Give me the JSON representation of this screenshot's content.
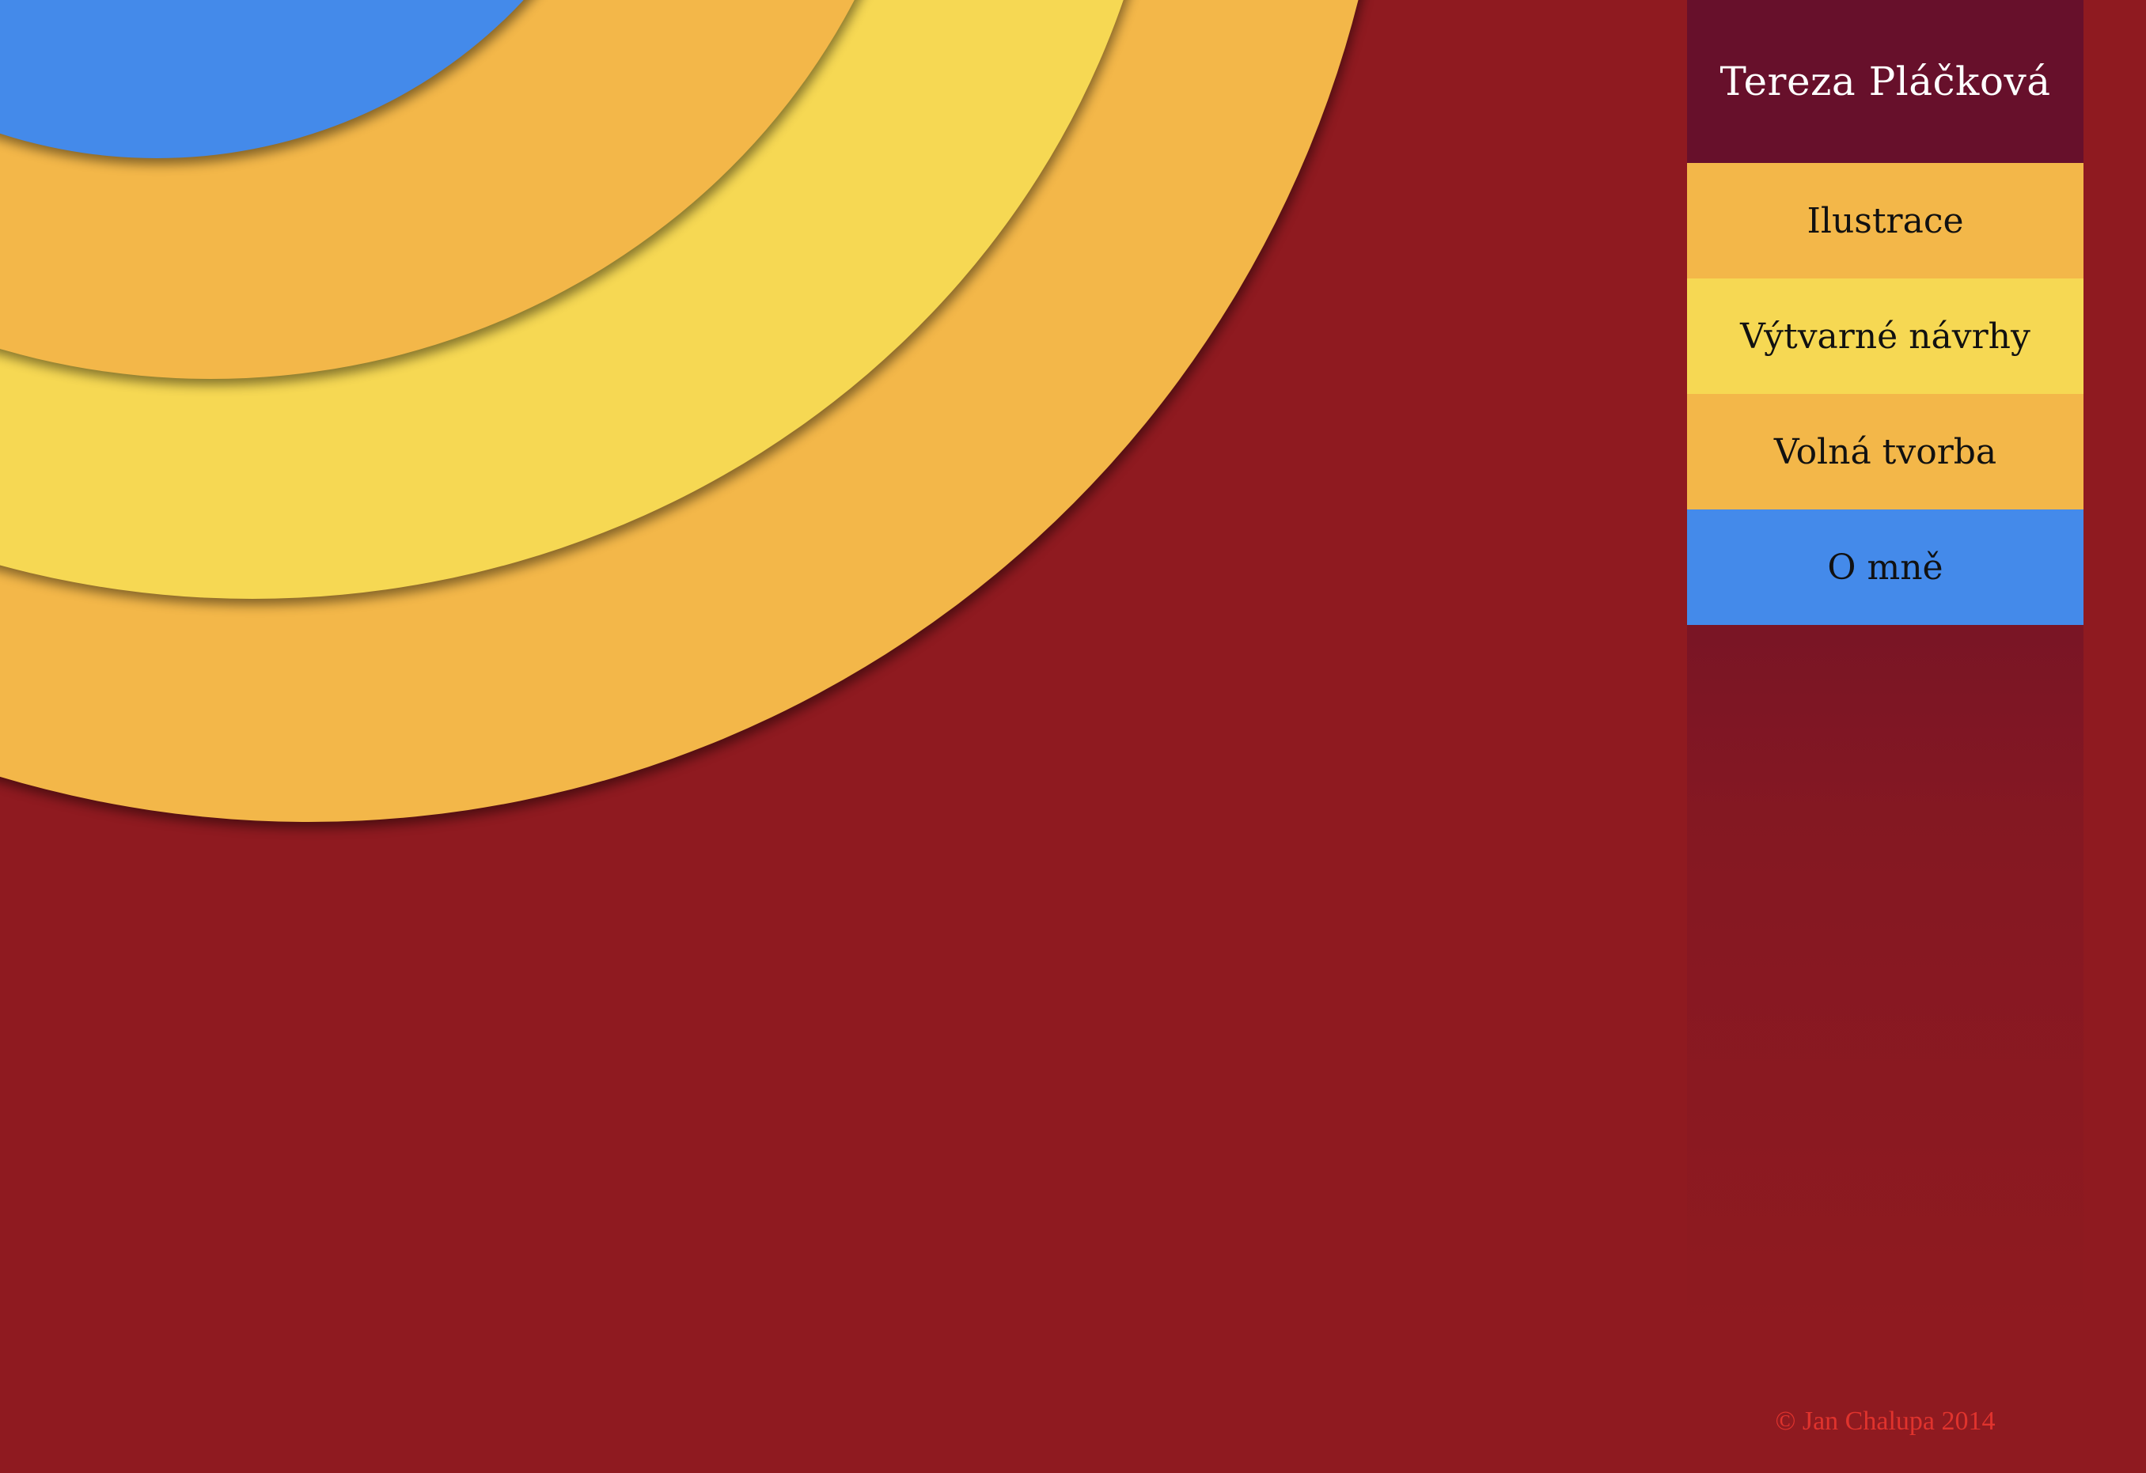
{
  "site": {
    "title": "Tereza Pláčková"
  },
  "nav": {
    "items": [
      {
        "label": "Ilustrace",
        "color": "#f3b749"
      },
      {
        "label": "Výtvarné návrhy",
        "color": "#f6d853"
      },
      {
        "label": "Volná tvorba",
        "color": "#f3b749"
      },
      {
        "label": "O mně",
        "color": "#448aea"
      }
    ]
  },
  "footer": {
    "copyright": "© Jan Chalupa 2014"
  },
  "colors": {
    "background": "#8f1a20",
    "sidebar_header": "#67102b",
    "orange": "#f3b749",
    "yellow": "#f6d853",
    "blue": "#448aea",
    "footer_text": "#e0332d"
  }
}
